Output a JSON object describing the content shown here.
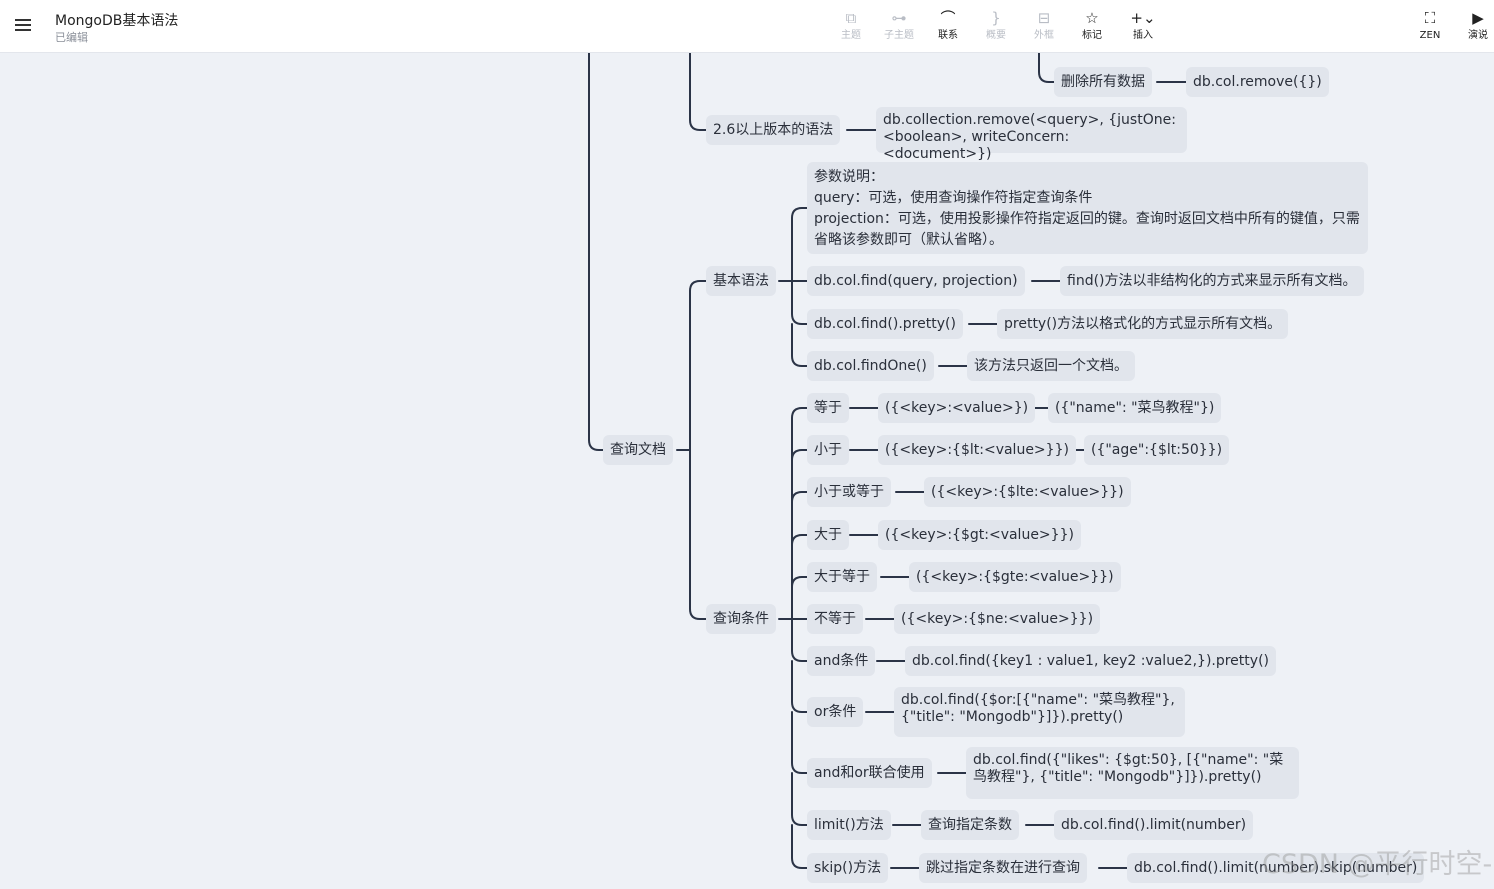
{
  "app": {
    "title": "MongoDB基本语法",
    "status": "已编辑"
  },
  "toolbar": {
    "topic": "主题",
    "subtopic": "子主题",
    "relation": "联系",
    "summary": "概要",
    "boundary": "外框",
    "marker": "标记",
    "insert": "插入",
    "zen": "ZEN",
    "present": "演说"
  },
  "map": {
    "delete_all": "删除所有数据",
    "remove_all_code": "db.col.remove({})",
    "v26_label": "2.6以上版本的语法",
    "v26_code": "db.collection.remove(<query>, {justOne: <boolean>, writeConcern: <document>})",
    "query_doc": "查询文档",
    "basic_syntax": "基本语法",
    "params_note": "参数说明：\nquery：可选，使用查询操作符指定查询条件\nprojection：可选，使用投影操作符指定返回的键。查询时返回文档中所有的键值，只需省略该参数即可（默认省略）。",
    "find_code": "db.col.find(query, projection)",
    "find_desc": "find()方法以非结构化的方式来显示所有文档。",
    "pretty_code": "db.col.find().pretty()",
    "pretty_desc": "pretty()方法以格式化的方式显示所有文档。",
    "findone_code": "db.col.findOne()",
    "findone_desc": "该方法只返回一个文档。",
    "conditions": "查询条件",
    "eq_label": "等于",
    "eq_syntax": "({<key>:<value>})",
    "eq_example": "({\"name\": \"菜鸟教程\"})",
    "lt_label": "小于",
    "lt_syntax": "({<key>:{$lt:<value>}})",
    "lt_example": "({\"age\":{$lt:50}})",
    "lte_label": "小于或等于",
    "lte_syntax": "({<key>:{$lte:<value>}})",
    "gt_label": "大于",
    "gt_syntax": "({<key>:{$gt:<value>}})",
    "gte_label": "大于等于",
    "gte_syntax": "({<key>:{$gte:<value>}})",
    "ne_label": "不等于",
    "ne_syntax": "({<key>:{$ne:<value>}})",
    "and_label": "and条件",
    "and_code": "db.col.find({key1 : value1, key2 :value2,}).pretty()",
    "or_label": "or条件",
    "or_code": "db.col.find({$or:[{\"name\": \"菜鸟教程\"},{\"title\": \"Mongodb\"}]}).pretty()",
    "andor_label": "and和or联合使用",
    "andor_code": "db.col.find({\"likes\": {$gt:50}, [{\"name\": \"菜鸟教程\"}, {\"title\": \"Mongodb\"}]}).pretty()",
    "limit_label": "limit()方法",
    "limit_desc": "查询指定条数",
    "limit_code": "db.col.find().limit(number)",
    "skip_label": "skip()方法",
    "skip_desc": "跳过指定条数在进行查询",
    "skip_code": "db.col.find().limit(number).skip(number)"
  },
  "watermark": "CSDN @平行时空-",
  "colors": {
    "background": "#eef1f6",
    "node": "#e1e5ec",
    "line": "#2b3447"
  }
}
